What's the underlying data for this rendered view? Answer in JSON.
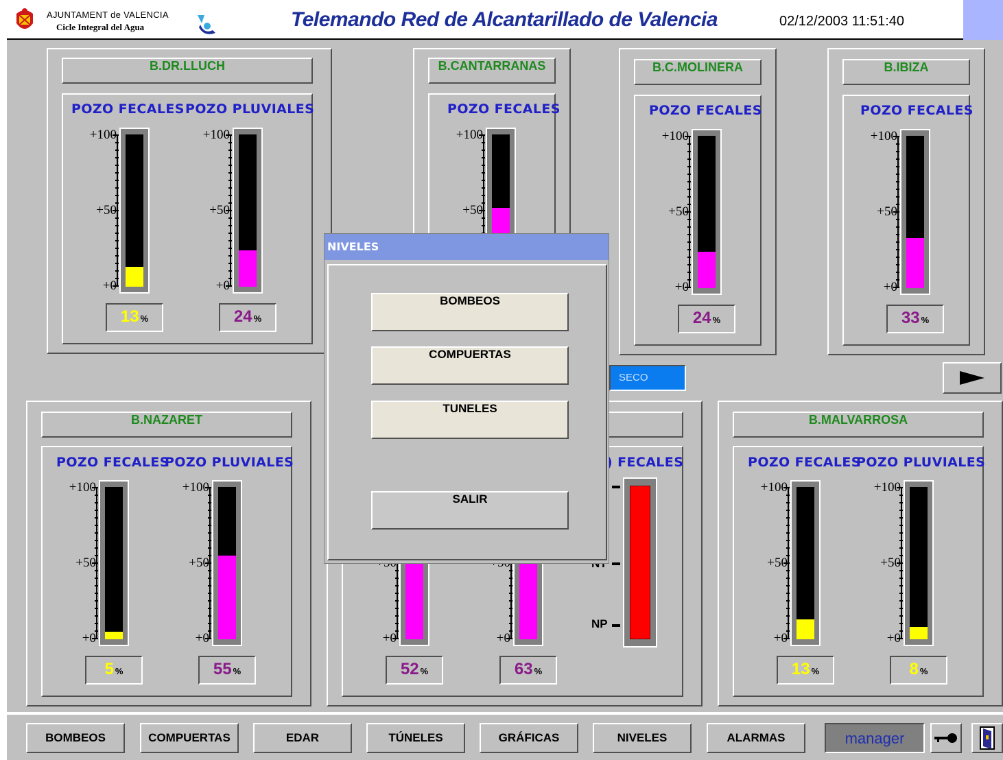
{
  "header": {
    "org_line1": "AJUNTAMENT de VALENCIA",
    "org_line2": "Cicle Integral del Agua",
    "title": "Telemando Red de Alcantarillado de Valencia",
    "datetime": "02/12/2003 11:51:40"
  },
  "colors": {
    "title": "#1d2f98",
    "station": "#1e8a1e",
    "pozo": "#2020c8",
    "fecales_low": "#ffff00",
    "level_fill": "#ff00ff",
    "alarm": "#ff0000",
    "dialog_title": "#7f97e0"
  },
  "scale": {
    "top": "+100",
    "mid": "+50",
    "bot": "+0",
    "unit": "%"
  },
  "stations": {
    "lluch": {
      "name": "B.DR.LLUCH",
      "f_label": "POZO FECALES",
      "p_label": "POZO PLUVIALES",
      "fecales": 13,
      "pluviales": 24
    },
    "cantarranas": {
      "name": "B.CANTARRANAS",
      "f_label": "POZO FECALES",
      "fecales": 52
    },
    "molinera": {
      "name": "B.C.MOLINERA",
      "f_label": "POZO FECALES",
      "fecales": 24
    },
    "ibiza": {
      "name": "B.IBIZA",
      "f_label": "POZO FECALES",
      "fecales": 33
    },
    "nazaret": {
      "name": "B.NAZARET",
      "f_label": "POZO FECALES",
      "p_label": "POZO PLUVIALES",
      "fecales": 5,
      "pluviales": 55
    },
    "middle": {
      "f_label": ") FECALES",
      "pct1": 52,
      "pct2": 63,
      "np_label": "NP",
      "nt_label": "NT"
    },
    "malvarrosa": {
      "name": "B.MALVARROSA",
      "f_label": "POZO FECALES",
      "p_label": "POZO PLUVIALES",
      "fecales": 13,
      "pluviales": 8
    }
  },
  "seco_label": "SECO",
  "dialog": {
    "title": "NIVELES",
    "buttons": [
      "BOMBEOS",
      "COMPUERTAS",
      "TUNELES"
    ],
    "exit": "SALIR"
  },
  "footer": {
    "buttons": [
      "BOMBEOS",
      "COMPUERTAS",
      "EDAR",
      "TÚNELES",
      "GRÁFICAS",
      "NIVELES",
      "ALARMAS"
    ],
    "user": "manager"
  }
}
